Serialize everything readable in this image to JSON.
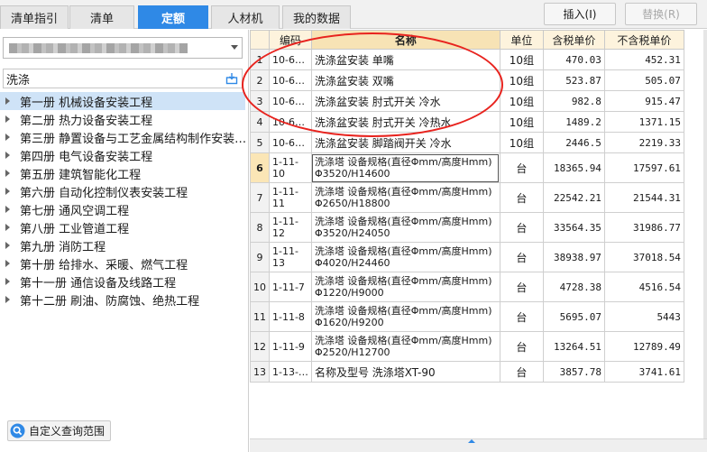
{
  "tabs": [
    {
      "label": "清单指引",
      "active": false
    },
    {
      "label": "清单",
      "active": false
    },
    {
      "label": "定额",
      "active": true
    },
    {
      "label": "人材机",
      "active": false
    },
    {
      "label": "我的数据",
      "active": false
    }
  ],
  "toolbar": {
    "insert_label": "插入(I)",
    "replace_label": "替换(R)"
  },
  "left": {
    "search_value": "洗涤",
    "tree": [
      "第一册 机械设备安装工程",
      "第二册 热力设备安装工程",
      "第三册 静置设备与工艺金属结构制作安装…",
      "第四册 电气设备安装工程",
      "第五册 建筑智能化工程",
      "第六册 自动化控制仪表安装工程",
      "第七册 通风空调工程",
      "第八册 工业管道工程",
      "第九册 消防工程",
      "第十册 给排水、采暖、燃气工程",
      "第十一册 通信设备及线路工程",
      "第十二册 刷油、防腐蚀、绝热工程"
    ],
    "footer_label": "自定义查询范围"
  },
  "grid": {
    "headers": [
      "编码",
      "名称",
      "单位",
      "含税单价",
      "不含税单价"
    ],
    "rows": [
      {
        "n": "1",
        "code": "10-6…",
        "name": "洗涤盆安装 单嘴",
        "unit": "10组",
        "tax": "470.03",
        "notax": "452.31"
      },
      {
        "n": "2",
        "code": "10-6…",
        "name": "洗涤盆安装 双嘴",
        "unit": "10组",
        "tax": "523.87",
        "notax": "505.07"
      },
      {
        "n": "3",
        "code": "10-6…",
        "name": "洗涤盆安装 肘式开关 冷水",
        "unit": "10组",
        "tax": "982.8",
        "notax": "915.47"
      },
      {
        "n": "4",
        "code": "10-6…",
        "name": "洗涤盆安装 肘式开关 冷热水",
        "unit": "10组",
        "tax": "1489.2",
        "notax": "1371.15"
      },
      {
        "n": "5",
        "code": "10-6…",
        "name": "洗涤盆安装 脚踏阀开关 冷水",
        "unit": "10组",
        "tax": "2446.5",
        "notax": "2219.33"
      },
      {
        "n": "6",
        "code": "1-11-10",
        "name": "洗涤塔 设备规格(直径Φmm/高度Hmm) Φ3520/H14600",
        "unit": "台",
        "tax": "18365.94",
        "notax": "17597.61"
      },
      {
        "n": "7",
        "code": "1-11-11",
        "name": "洗涤塔 设备规格(直径Φmm/高度Hmm) Φ2650/H18800",
        "unit": "台",
        "tax": "22542.21",
        "notax": "21544.31"
      },
      {
        "n": "8",
        "code": "1-11-12",
        "name": "洗涤塔 设备规格(直径Φmm/高度Hmm) Φ3520/H24050",
        "unit": "台",
        "tax": "33564.35",
        "notax": "31986.77"
      },
      {
        "n": "9",
        "code": "1-11-13",
        "name": "洗涤塔 设备规格(直径Φmm/高度Hmm) Φ4020/H24460",
        "unit": "台",
        "tax": "38938.97",
        "notax": "37018.54"
      },
      {
        "n": "10",
        "code": "1-11-7",
        "name": "洗涤塔 设备规格(直径Φmm/高度Hmm) Φ1220/H9000",
        "unit": "台",
        "tax": "4728.38",
        "notax": "4516.54"
      },
      {
        "n": "11",
        "code": "1-11-8",
        "name": "洗涤塔 设备规格(直径Φmm/高度Hmm) Φ1620/H9200",
        "unit": "台",
        "tax": "5695.07",
        "notax": "5443"
      },
      {
        "n": "12",
        "code": "1-11-9",
        "name": "洗涤塔 设备规格(直径Φmm/高度Hmm) Φ2520/H12700",
        "unit": "台",
        "tax": "13264.51",
        "notax": "12789.49"
      },
      {
        "n": "13",
        "code": "1-13-…",
        "name": "名称及型号 洗涤塔XT-90",
        "unit": "台",
        "tax": "3857.78",
        "notax": "3741.61"
      }
    ]
  },
  "colors": {
    "accent": "#2f89e6",
    "header_bg": "#fdf3dd",
    "annotation": "#e8231e",
    "selected": "#cfe3f7"
  }
}
